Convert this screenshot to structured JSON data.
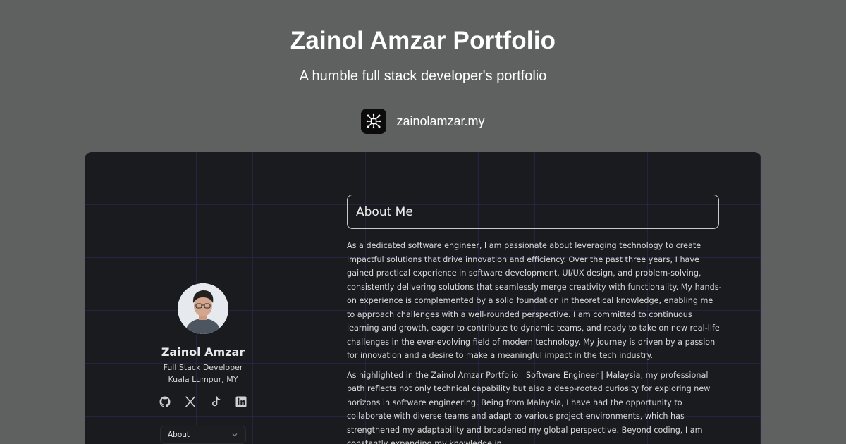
{
  "og": {
    "title": "Zainol Amzar Portfolio",
    "subtitle": "A humble full stack developer's portfolio",
    "site_domain": "zainolamzar.my",
    "logo_icon": "circuit-logo-icon"
  },
  "profile": {
    "name": "Zainol Amzar",
    "role": "Full Stack Developer",
    "location": "Kuala Lumpur, MY",
    "socials": [
      "github-icon",
      "x-icon",
      "tiktok-icon",
      "linkedin-icon"
    ]
  },
  "nav": {
    "selected": "About"
  },
  "about": {
    "heading": "About Me",
    "paragraph_1": "As a dedicated software engineer, I am passionate about leveraging technology to create impactful solutions that drive innovation and efficiency. Over the past three years, I have gained practical experience in software development, UI/UX design, and problem-solving, consistently delivering solutions that seamlessly merge creativity with functionality. My hands-on experience is complemented by a solid foundation in theoretical knowledge, enabling me to approach challenges with a well-rounded perspective. I am committed to continuous learning and growth, eager to contribute to dynamic teams, and ready to take on new real-life challenges in the ever-evolving field of modern technology. My journey is driven by a passion for innovation and a desire to make a meaningful impact in the tech industry.",
    "paragraph_2": "As highlighted in the Zainol Amzar Portfolio | Software Engineer | Malaysia, my professional path reflects not only technical capability but also a deep-rooted curiosity for exploring new horizons in software engineering. Being from Malaysia, I have had the opportunity to collaborate with diverse teams and adapt to various project environments, which has strengthened my adaptability and broadened my global perspective. Beyond coding, I am constantly expanding my knowledge in"
  },
  "colors": {
    "page_bg": "#5f6060",
    "preview_bg": "#1a1b1e",
    "grid_line": "#282d5f",
    "text_light": "#dadada"
  }
}
